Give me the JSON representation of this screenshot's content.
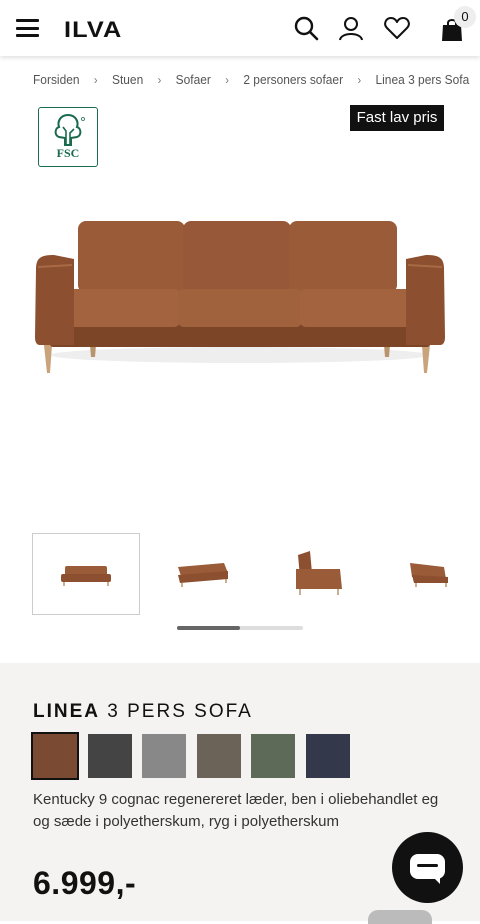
{
  "header": {
    "logo": "ILVA",
    "bag_count": "0",
    "icons": [
      "menu-icon",
      "search-icon",
      "user-icon",
      "heart-icon",
      "bag-icon"
    ]
  },
  "breadcrumb": [
    "Forsiden",
    "Stuen",
    "Sofaer",
    "2 personers sofaer",
    "Linea 3 pers Sofa"
  ],
  "breadcrumb_separator": "›",
  "fsc_label": "FSC",
  "badge": "Fast lav pris",
  "product": {
    "name_bold": "LINEA",
    "name_rest": " 3 PERS SOFA",
    "colors": [
      "#7a4a33",
      "#444444",
      "#888888",
      "#6b6258",
      "#5e6a58",
      "#33394a"
    ],
    "selected_color_index": 0,
    "description": "Kentucky 9 cognac regenereret læder, ben i oliebehandlet eg og sæde i polyetherskum, ryg i polyetherskum",
    "price": "6.999,-"
  },
  "gallery": {
    "thumb_count": 4,
    "active_index": 0,
    "scroll_fraction": 0.5
  },
  "colors": {
    "leather": "#9a5b38",
    "leather_dark": "#7c4528",
    "legs": "#c9a37a",
    "fsc_green": "#1a6a4e"
  }
}
